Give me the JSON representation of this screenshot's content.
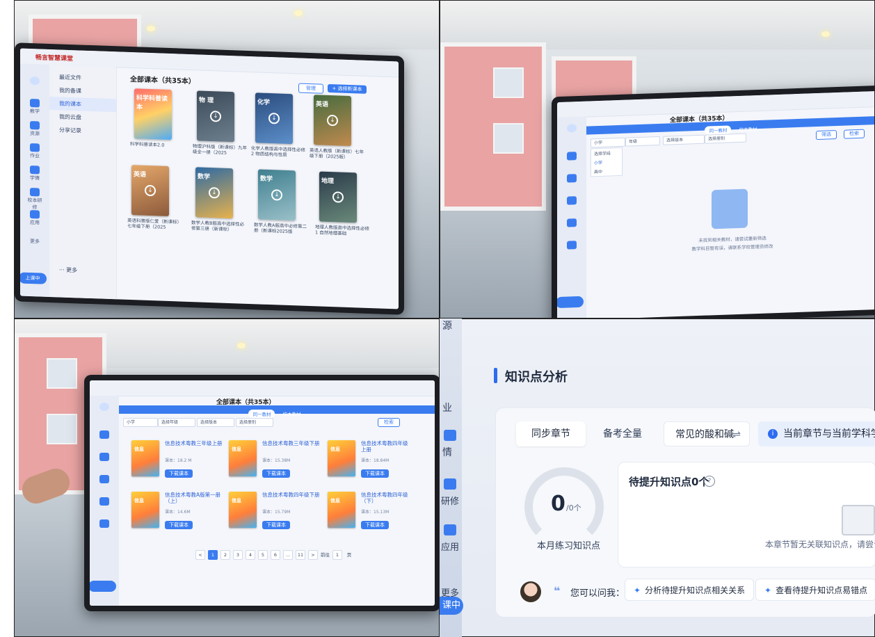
{
  "cell1": {
    "brand": "畅言智慧课堂",
    "sidebar_items": [
      "最近文件",
      "我的备课",
      "我的课本",
      "我的云盘",
      "分享记录"
    ],
    "left_nav": [
      "教学",
      "资源",
      "作业",
      "学情",
      "校本研修",
      "应用"
    ],
    "left_nav_more": "更多",
    "start_class": "上课中",
    "title": "全部课本（共35本）",
    "btn_manage": "管理",
    "btn_add": "+ 选择新课本",
    "books": [
      {
        "cover_text": "科学科普读本",
        "caption": "科学科普读本2.0"
      },
      {
        "cover_text": "物 理",
        "caption": "物理沪科版（新课标）九年级全一册（2025"
      },
      {
        "cover_text": "化学",
        "caption": "化学人教版高中选择性必修2 物质结构与性质"
      },
      {
        "cover_text": "英语",
        "caption": "英语人教版（新课标）七年级下册（2025版）"
      },
      {
        "cover_text": "英语",
        "caption": "英语科普版仁爱（新课标）七年级下册（2025"
      },
      {
        "cover_text": "数学",
        "caption": "数学人教B版高中选择性必修第三册（新课标）"
      },
      {
        "cover_text": "数学",
        "caption": "数学人教A版高中必修第二册（新课标2025版"
      },
      {
        "cover_text": "地理",
        "caption": "地理人教版高中选择性必修1 自然地理基础"
      }
    ],
    "footer_more": "··· 更多"
  },
  "cell2": {
    "title": "全部课本（共35本）",
    "tabs": [
      "同一教材",
      "校本教材"
    ],
    "filters": [
      "小学",
      "年级",
      "选择版本",
      "选择册别"
    ],
    "dropdown": [
      "选择学段",
      "小学",
      "高中"
    ],
    "btn_filter": "筛选",
    "btn_search": "检索",
    "empty_line1": "未找到相关教材，请尝试重新筛选",
    "empty_line2": "教学科目暂有误，请联系学校管理员修改"
  },
  "cell3": {
    "title": "全部课本（共35本）",
    "tabs": [
      "同一教材",
      "校本教材"
    ],
    "filters": [
      "小学",
      "选择年级",
      "选择版本",
      "选择册别"
    ],
    "btn_filter": "检索",
    "download_label": "下载课本",
    "books": [
      {
        "title": "信息技术粤教三年级上册",
        "size": "课本：18.2 M"
      },
      {
        "title": "信息技术粤教三年级下册",
        "size": "课本：15.38M"
      },
      {
        "title": "信息技术粤教四年级上册",
        "size": "课本：18.84M"
      },
      {
        "title": "信息技术粤教A版第一册（上）",
        "size": "课本：14.6M"
      },
      {
        "title": "信息技术粤教四年级下册",
        "size": "课本：15.79M"
      },
      {
        "title": "信息技术粤教四年级（下）",
        "size": "课本：15.13M"
      }
    ],
    "pages": [
      "<",
      "1",
      "2",
      "3",
      "4",
      "5",
      "6",
      "...",
      "11",
      ">"
    ],
    "goto": "前往",
    "goto_page": "1",
    "page_unit": "页"
  },
  "cell4": {
    "left_nav": [
      "源",
      "业",
      "情",
      "研修",
      "应用",
      "更多"
    ],
    "start_class": "课中",
    "section_title": "知识点分析",
    "seg_tabs": [
      "同步章节",
      "备考全量"
    ],
    "chapter": "常见的酸和碱",
    "chapter_switch": "⇌",
    "tip": "当前章节与当前学科学提",
    "gauge_value": "0",
    "gauge_unit": "/0个",
    "gauge_label": "本月练习知识点",
    "card_title": "待提升知识点0个",
    "card_empty": "本章节暂无关联知识点，请尝试",
    "ask_label": "您可以问我：",
    "chips": [
      "分析待提升知识点相关关系",
      "查看待提升知识点易错点"
    ]
  }
}
